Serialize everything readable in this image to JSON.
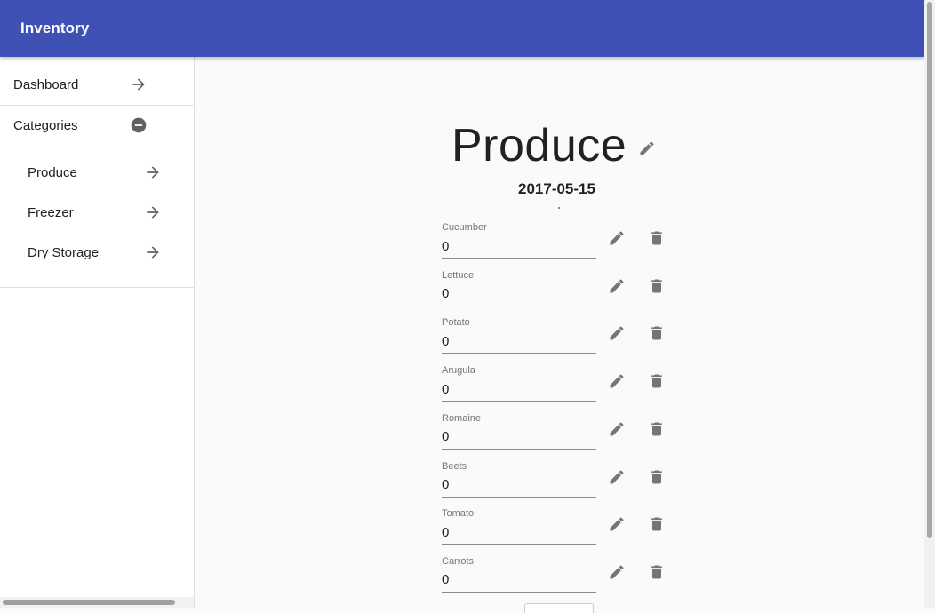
{
  "app": {
    "title": "Inventory"
  },
  "sidebar": {
    "dashboard": {
      "label": "Dashboard"
    },
    "categories": {
      "label": "Categories",
      "items": [
        {
          "label": "Produce"
        },
        {
          "label": "Freezer"
        },
        {
          "label": "Dry Storage"
        }
      ]
    }
  },
  "category": {
    "title": "Produce",
    "date": "2017-05-15"
  },
  "items": [
    {
      "name": "Cucumber",
      "quantity": "0"
    },
    {
      "name": "Lettuce",
      "quantity": "0"
    },
    {
      "name": "Potato",
      "quantity": "0"
    },
    {
      "name": "Arugula",
      "quantity": "0"
    },
    {
      "name": "Romaine",
      "quantity": "0"
    },
    {
      "name": "Beets",
      "quantity": "0"
    },
    {
      "name": "Tomato",
      "quantity": "0"
    },
    {
      "name": "Carrots",
      "quantity": "0"
    }
  ],
  "icons": {
    "nav": "arrow-forward-icon",
    "collapse": "remove-circle-icon",
    "edit": "pencil-icon",
    "delete": "trash-icon"
  },
  "colors": {
    "primary": "#3f51b5",
    "icon": "#757575",
    "background": "#fafafa"
  }
}
